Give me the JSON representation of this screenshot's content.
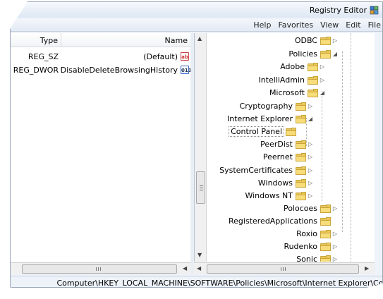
{
  "window": {
    "title": "Registry Editor",
    "menu": [
      "File",
      "Edit",
      "View",
      "Favorites",
      "Help"
    ]
  },
  "list": {
    "columns": {
      "name": "Name",
      "type": "Type"
    },
    "rows": [
      {
        "name": "(Default)",
        "type": "REG_SZ",
        "icon": "string-value-icon",
        "icon_text": "ab"
      },
      {
        "name": "DisableDeleteBrowsingHistory",
        "type": "REG_DWOR",
        "icon": "dword-value-icon",
        "icon_text": "011"
      }
    ]
  },
  "tree": {
    "nodes": [
      {
        "label": "ODBC",
        "expander": "▷"
      },
      {
        "label": "Policies",
        "expander": "◢"
      },
      {
        "label": "Adobe",
        "expander": "▷"
      },
      {
        "label": "IntelliAdmin",
        "expander": "▷"
      },
      {
        "label": "Microsoft",
        "expander": "◢"
      },
      {
        "label": "Cryptography",
        "expander": "▷"
      },
      {
        "label": "Internet Explorer",
        "expander": "◢"
      },
      {
        "label": "Control Panel",
        "expander": ""
      },
      {
        "label": "PeerDist",
        "expander": "▷"
      },
      {
        "label": "Peernet",
        "expander": "▷"
      },
      {
        "label": "SystemCertificates",
        "expander": "▷"
      },
      {
        "label": "Windows",
        "expander": "▷"
      },
      {
        "label": "Windows NT",
        "expander": "▷"
      },
      {
        "label": "Polocoes",
        "expander": "▷"
      },
      {
        "label": "RegisteredApplications",
        "expander": ""
      },
      {
        "label": "Roxio",
        "expander": "▷"
      },
      {
        "label": "Rudenko",
        "expander": "▷"
      },
      {
        "label": "Sonic",
        "expander": "▷"
      }
    ]
  },
  "status": {
    "path": "Computer\\HKEY_LOCAL_MACHINE\\SOFTWARE\\Policies\\Microsoft\\Internet Explorer\\Control Panel"
  }
}
